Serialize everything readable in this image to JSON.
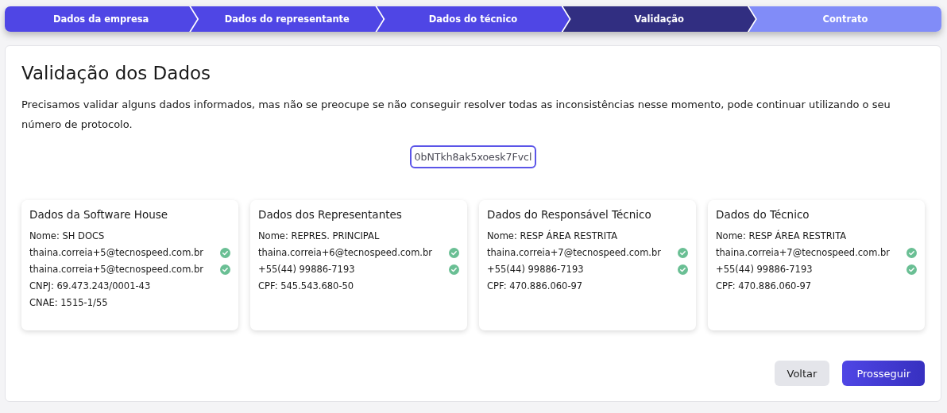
{
  "steps": [
    {
      "label": "Dados da empresa",
      "kind": "done"
    },
    {
      "label": "Dados do representante",
      "kind": "done"
    },
    {
      "label": "Dados do técnico",
      "kind": "done"
    },
    {
      "label": "Validação",
      "kind": "current"
    },
    {
      "label": "Contrato",
      "kind": "upcoming"
    }
  ],
  "title": "Validação dos Dados",
  "description": "Precisamos validar alguns dados informados, mas não se preocupe se não conseguir resolver todas as inconsistências nesse momento, pode continuar utilizando o seu número de protocolo.",
  "protocol": "0bNTkh8ak5xoesk7Fvcl",
  "cards": [
    {
      "title": "Dados da Software House",
      "lines": [
        {
          "text": "Nome: SH DOCS",
          "verified": false
        },
        {
          "text": "thaina.correia+5@tecnospeed.com.br",
          "verified": true
        },
        {
          "text": "thaina.correia+5@tecnospeed.com.br",
          "verified": true
        },
        {
          "text": "CNPJ: 69.473.243/0001-43",
          "verified": false
        },
        {
          "text": "CNAE: 1515-1/55",
          "verified": false
        }
      ]
    },
    {
      "title": "Dados dos Representantes",
      "lines": [
        {
          "text": "Nome: REPRES. PRINCIPAL",
          "verified": false
        },
        {
          "text": "thaina.correia+6@tecnospeed.com.br",
          "verified": true
        },
        {
          "text": "+55(44) 99886-7193",
          "verified": true
        },
        {
          "text": "CPF: 545.543.680-50",
          "verified": false
        }
      ]
    },
    {
      "title": "Dados do Responsável Técnico",
      "lines": [
        {
          "text": "Nome: RESP ÁREA RESTRITA",
          "verified": false
        },
        {
          "text": "thaina.correia+7@tecnospeed.com.br",
          "verified": true
        },
        {
          "text": "+55(44) 99886-7193",
          "verified": true
        },
        {
          "text": "CPF: 470.886.060-97",
          "verified": false
        }
      ]
    },
    {
      "title": "Dados do Técnico",
      "lines": [
        {
          "text": "Nome: RESP ÁREA RESTRITA",
          "verified": false
        },
        {
          "text": "thaina.correia+7@tecnospeed.com.br",
          "verified": true
        },
        {
          "text": "+55(44) 99886-7193",
          "verified": true
        },
        {
          "text": "CPF: 470.886.060-97",
          "verified": false
        }
      ]
    }
  ],
  "buttons": [
    {
      "label": "Voltar",
      "kind": "secondary"
    },
    {
      "label": "Prosseguir",
      "kind": "primary"
    }
  ]
}
